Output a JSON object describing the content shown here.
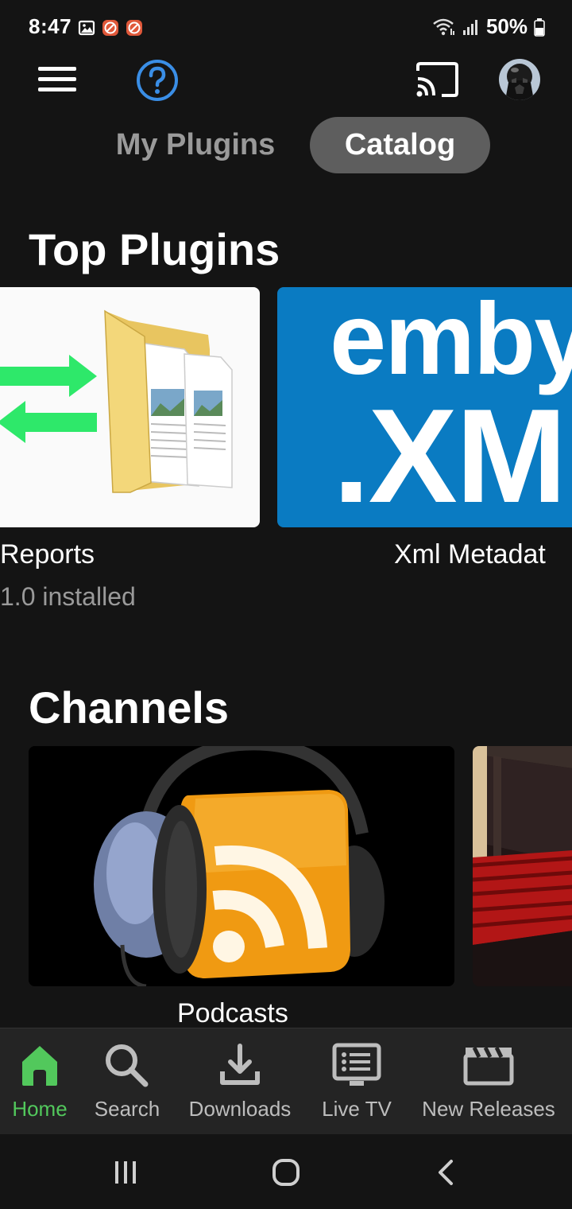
{
  "status_bar": {
    "time": "8:47",
    "left_icons": [
      "gallery-icon",
      "app-notification-icon",
      "app-notification-icon"
    ],
    "right_icons": [
      "wifi-icon",
      "signal-icon",
      "battery-icon"
    ],
    "battery": "50%"
  },
  "toolbar": {
    "menu_icon": "hamburger-menu-icon",
    "help_icon": "help-circle-icon",
    "cast_icon": "cast-icon",
    "avatar": "user-avatar"
  },
  "tabs": [
    {
      "label": "My Plugins",
      "active": false
    },
    {
      "label": "Catalog",
      "active": true
    }
  ],
  "sections": {
    "top_plugins": {
      "title": "Top Plugins",
      "items": [
        {
          "title": "Reports",
          "subtitle": "1.0 installed"
        },
        {
          "title": "Xml Metadat",
          "logo_line1": "emby",
          "logo_line2": ".XM"
        }
      ]
    },
    "channels": {
      "title": "Channels",
      "items": [
        {
          "title": "Podcasts"
        },
        {
          "title": ""
        }
      ]
    }
  },
  "bottom_nav": [
    {
      "label": "Home",
      "icon": "home-icon",
      "active": true
    },
    {
      "label": "Search",
      "icon": "search-icon",
      "active": false
    },
    {
      "label": "Downloads",
      "icon": "download-icon",
      "active": false
    },
    {
      "label": "Live TV",
      "icon": "live-tv-icon",
      "active": false
    },
    {
      "label": "New Releases",
      "icon": "clapperboard-icon",
      "active": false
    }
  ],
  "system_nav": [
    "recent-apps-icon",
    "home-circle-icon",
    "back-icon"
  ],
  "colors": {
    "background": "#141414",
    "accent_green": "#52c85c",
    "help_blue": "#3a8ee6",
    "emby_blue": "#0a7bc2",
    "tab_active_bg": "#5e5e5e"
  }
}
